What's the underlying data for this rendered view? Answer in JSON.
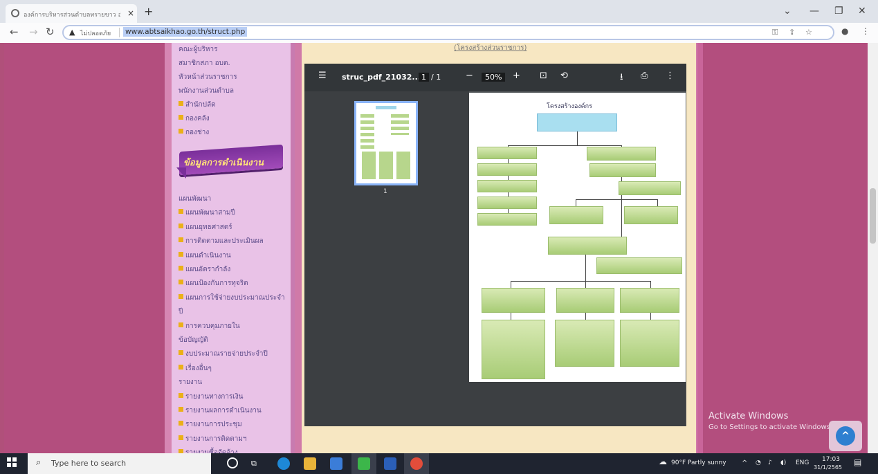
{
  "browser": {
    "tab_title": "องค์การบริหารส่วนตำบลทรายขาว อำ",
    "tab_close": "×",
    "new_tab": "+",
    "security_label": "ไม่ปลอดภัย",
    "url": "www.abtsaikhao.go.th/struct.php"
  },
  "sidebar": {
    "top_items": [
      {
        "label": "คณะผู้บริหาร",
        "bullet": false
      },
      {
        "label": "สมาชิกสภา อบต.",
        "bullet": false
      },
      {
        "label": "หัวหน้าส่วนราชการ",
        "bullet": false
      },
      {
        "label": "พนักงานส่วนตำบล",
        "bullet": false
      },
      {
        "label": "สำนักปลัด",
        "bullet": true
      },
      {
        "label": "กองคลัง",
        "bullet": true
      },
      {
        "label": "กองช่าง",
        "bullet": true
      }
    ],
    "banner": "ข้อมูลการดำเนินงาน",
    "items": [
      {
        "label": "แผนพัฒนา",
        "bullet": false
      },
      {
        "label": "แผนพัฒนาสามปี",
        "bullet": true
      },
      {
        "label": "แผนยุทธศาสตร์",
        "bullet": true
      },
      {
        "label": "การติดตามและประเมินผล",
        "bullet": true
      },
      {
        "label": "แผนดำเนินงาน",
        "bullet": true
      },
      {
        "label": "แผนอัตรากำลัง",
        "bullet": true
      },
      {
        "label": "แผนป้องกันการทุจริต",
        "bullet": true
      },
      {
        "label": "แผนการใช้จ่ายงบประมาณประจำ",
        "bullet": true
      },
      {
        "label": "ปี",
        "bullet": false
      },
      {
        "label": "การควบคุมภายใน",
        "bullet": true
      },
      {
        "label": "ข้อบัญญัติ",
        "bullet": false
      },
      {
        "label": "งบประมาณรายจ่ายประจำปี",
        "bullet": true
      },
      {
        "label": "เรื่องอื่นๆ",
        "bullet": true
      },
      {
        "label": "รายงาน",
        "bullet": false
      },
      {
        "label": "รายงานทางการเงิน",
        "bullet": true
      },
      {
        "label": "รายงานผลการดำเนินงาน",
        "bullet": true
      },
      {
        "label": "รายงานการประชุม",
        "bullet": true
      },
      {
        "label": "รายงานการติดตามฯ",
        "bullet": true
      },
      {
        "label": "รายงานซื้อจัดจ้าง",
        "bullet": true
      }
    ]
  },
  "content": {
    "heading_partial": "(โครงสร้างส่วนราชการ)"
  },
  "pdf": {
    "filename": "struc_pdf_21032...",
    "page_current": "1",
    "page_total": "/ 1",
    "zoom_minus": "−",
    "zoom": "50%",
    "zoom_plus": "+",
    "thumb_page": "1",
    "page_title": "โครงสร้างองค์กร"
  },
  "activation": {
    "title": "Activate Windows",
    "subtitle": "Go to Settings to activate Windows."
  },
  "taskbar": {
    "search_placeholder": "Type here to search",
    "weather": "90°F  Partly sunny",
    "lang": "ENG",
    "time": "17:03",
    "date": "31/1/2565"
  },
  "colors": {
    "page_bg": "#b0507a",
    "sidebar_bg": "#e9c2e7",
    "content_bg": "#f7e7c2",
    "pdf_toolbar": "#323639",
    "org_box": "#b7d68c"
  }
}
